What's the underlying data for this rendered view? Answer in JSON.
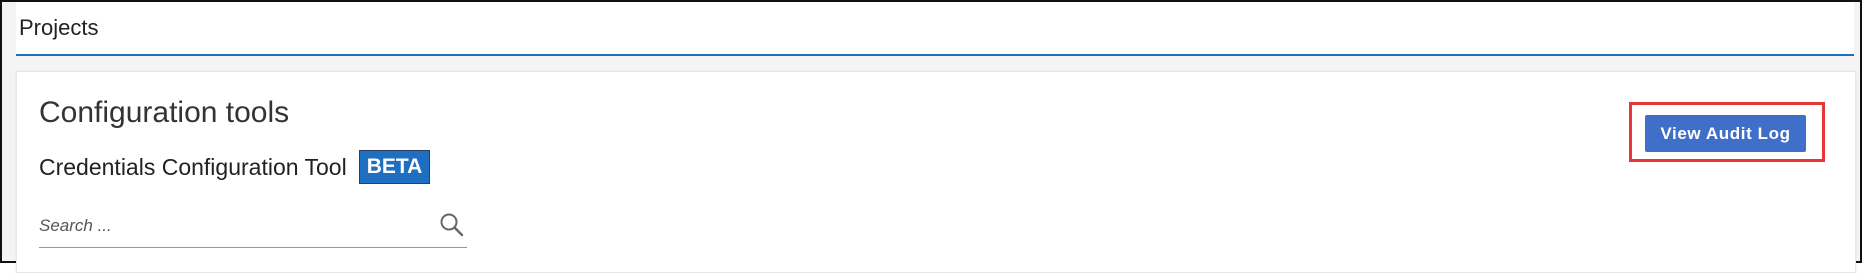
{
  "header": {
    "title": "Projects"
  },
  "card": {
    "title": "Configuration tools",
    "tool_name": "Credentials Configuration Tool",
    "badge": "BETA"
  },
  "search": {
    "placeholder": "Search ...",
    "value": "",
    "icon": "search-icon"
  },
  "actions": {
    "audit_label": "View Audit Log"
  },
  "colors": {
    "accent": "#1f6fc1",
    "button": "#3f6fc9",
    "highlight": "#e53935"
  }
}
